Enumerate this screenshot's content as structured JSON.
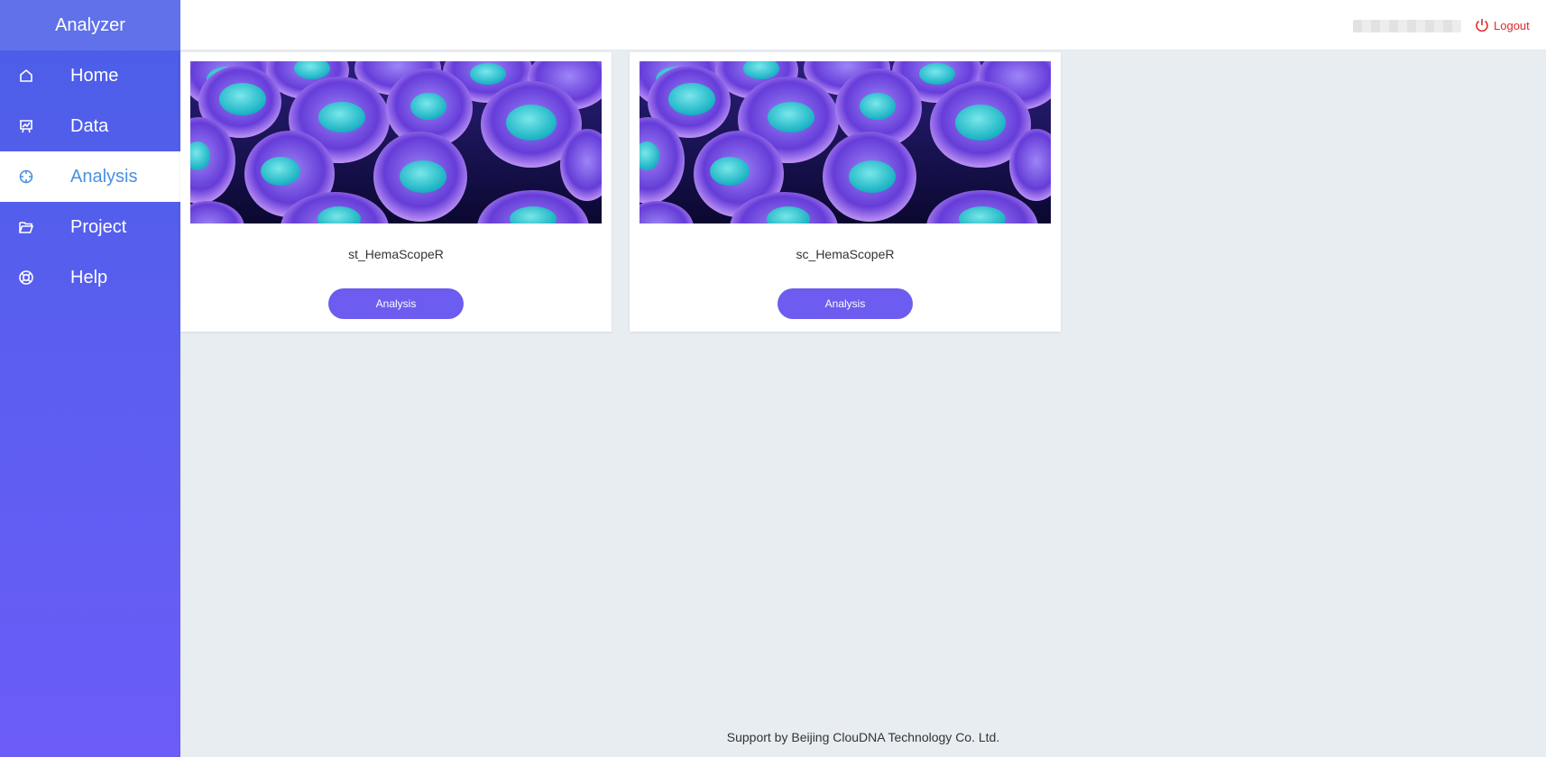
{
  "sidebar": {
    "brand": "Analyzer",
    "items": [
      {
        "label": "Home",
        "icon": "home-icon"
      },
      {
        "label": "Data",
        "icon": "chart-board-icon"
      },
      {
        "label": "Analysis",
        "icon": "crosshair-icon",
        "active": true
      },
      {
        "label": "Project",
        "icon": "folder-open-icon"
      },
      {
        "label": "Help",
        "icon": "lifebuoy-icon"
      }
    ]
  },
  "header": {
    "user_name": "",
    "logout_label": "Logout"
  },
  "cards": [
    {
      "title": "st_HemaScopeR",
      "button_label": "Analysis",
      "image": "cell-microscopy-image"
    },
    {
      "title": "sc_HemaScopeR",
      "button_label": "Analysis",
      "image": "cell-microscopy-image"
    }
  ],
  "footer": {
    "text": "Support by Beijing ClouDNA Technology Co. Ltd."
  },
  "colors": {
    "sidebar_top": "#4a5ee6",
    "sidebar_bottom": "#6c5cf8",
    "active_text": "#4a90e2",
    "button": "#6c5cf0",
    "logout": "#e0292a",
    "background": "#e8edf2"
  }
}
